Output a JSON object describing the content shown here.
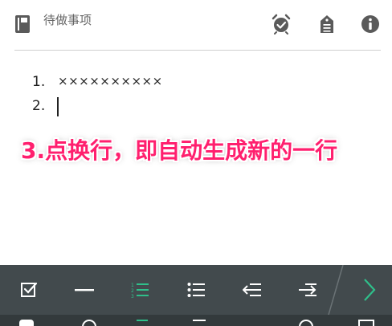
{
  "header": {
    "title": "待做事项",
    "icons": [
      "notebook-icon",
      "alarm-check-icon",
      "tag-list-icon",
      "info-icon"
    ]
  },
  "list": {
    "items": [
      {
        "number": "1.",
        "text": "××××××××××"
      },
      {
        "number": "2.",
        "text": ""
      }
    ]
  },
  "caption": "3.点换行，即自动生成新的一行",
  "toolbar": {
    "buttons": [
      "checkbox",
      "horizontal-line",
      "numbered-list",
      "bullet-list",
      "outdent",
      "indent",
      "next"
    ],
    "active": "numbered-list",
    "colors": {
      "background": "#424a4d",
      "icon": "#ffffff",
      "active": "#2fbf8a",
      "next": "#2fbf8a"
    }
  }
}
